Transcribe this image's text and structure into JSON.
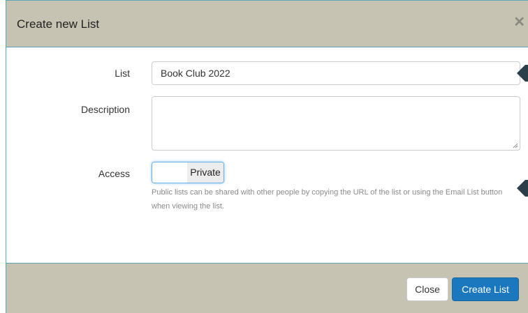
{
  "modal": {
    "title": "Create new List",
    "close_icon": "close-icon"
  },
  "form": {
    "list_label": "List",
    "list_value": "Book Club 2022",
    "description_label": "Description",
    "description_value": "",
    "access_label": "Access",
    "access_toggle_label": "Private",
    "access_help": "Public lists can be shared with other people by copying the URL of the list or using the Email List button when viewing the list."
  },
  "footer": {
    "close_label": "Close",
    "create_label": "Create List"
  },
  "colors": {
    "header_bg": "#c6c3b2",
    "accent": "#1b78bf",
    "border": "#5fa3b8"
  }
}
